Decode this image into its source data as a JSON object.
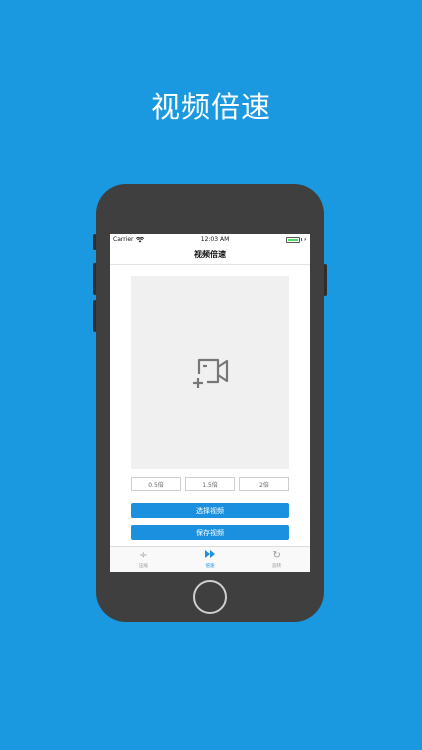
{
  "headline": "视频倍速",
  "colors": {
    "background": "#1a98e0",
    "accent": "#1a90de",
    "battery": "#4cd964"
  },
  "status_bar": {
    "carrier": "Carrier",
    "time": "12:03 AM",
    "wifi_icon": "wifi-icon",
    "battery_icon": "battery-icon"
  },
  "nav": {
    "title": "视频倍速"
  },
  "preview": {
    "icon": "add-video-icon"
  },
  "speed_options": [
    "0.5倍",
    "1.5倍",
    "2倍"
  ],
  "buttons": {
    "select_video": "选择视频",
    "save_video": "保存视频"
  },
  "tabs": [
    {
      "label": "压缩",
      "icon": "compress-icon",
      "active": false
    },
    {
      "label": "倍速",
      "icon": "fast-forward-icon",
      "active": true
    },
    {
      "label": "旋转",
      "icon": "rotate-icon",
      "active": false
    }
  ]
}
